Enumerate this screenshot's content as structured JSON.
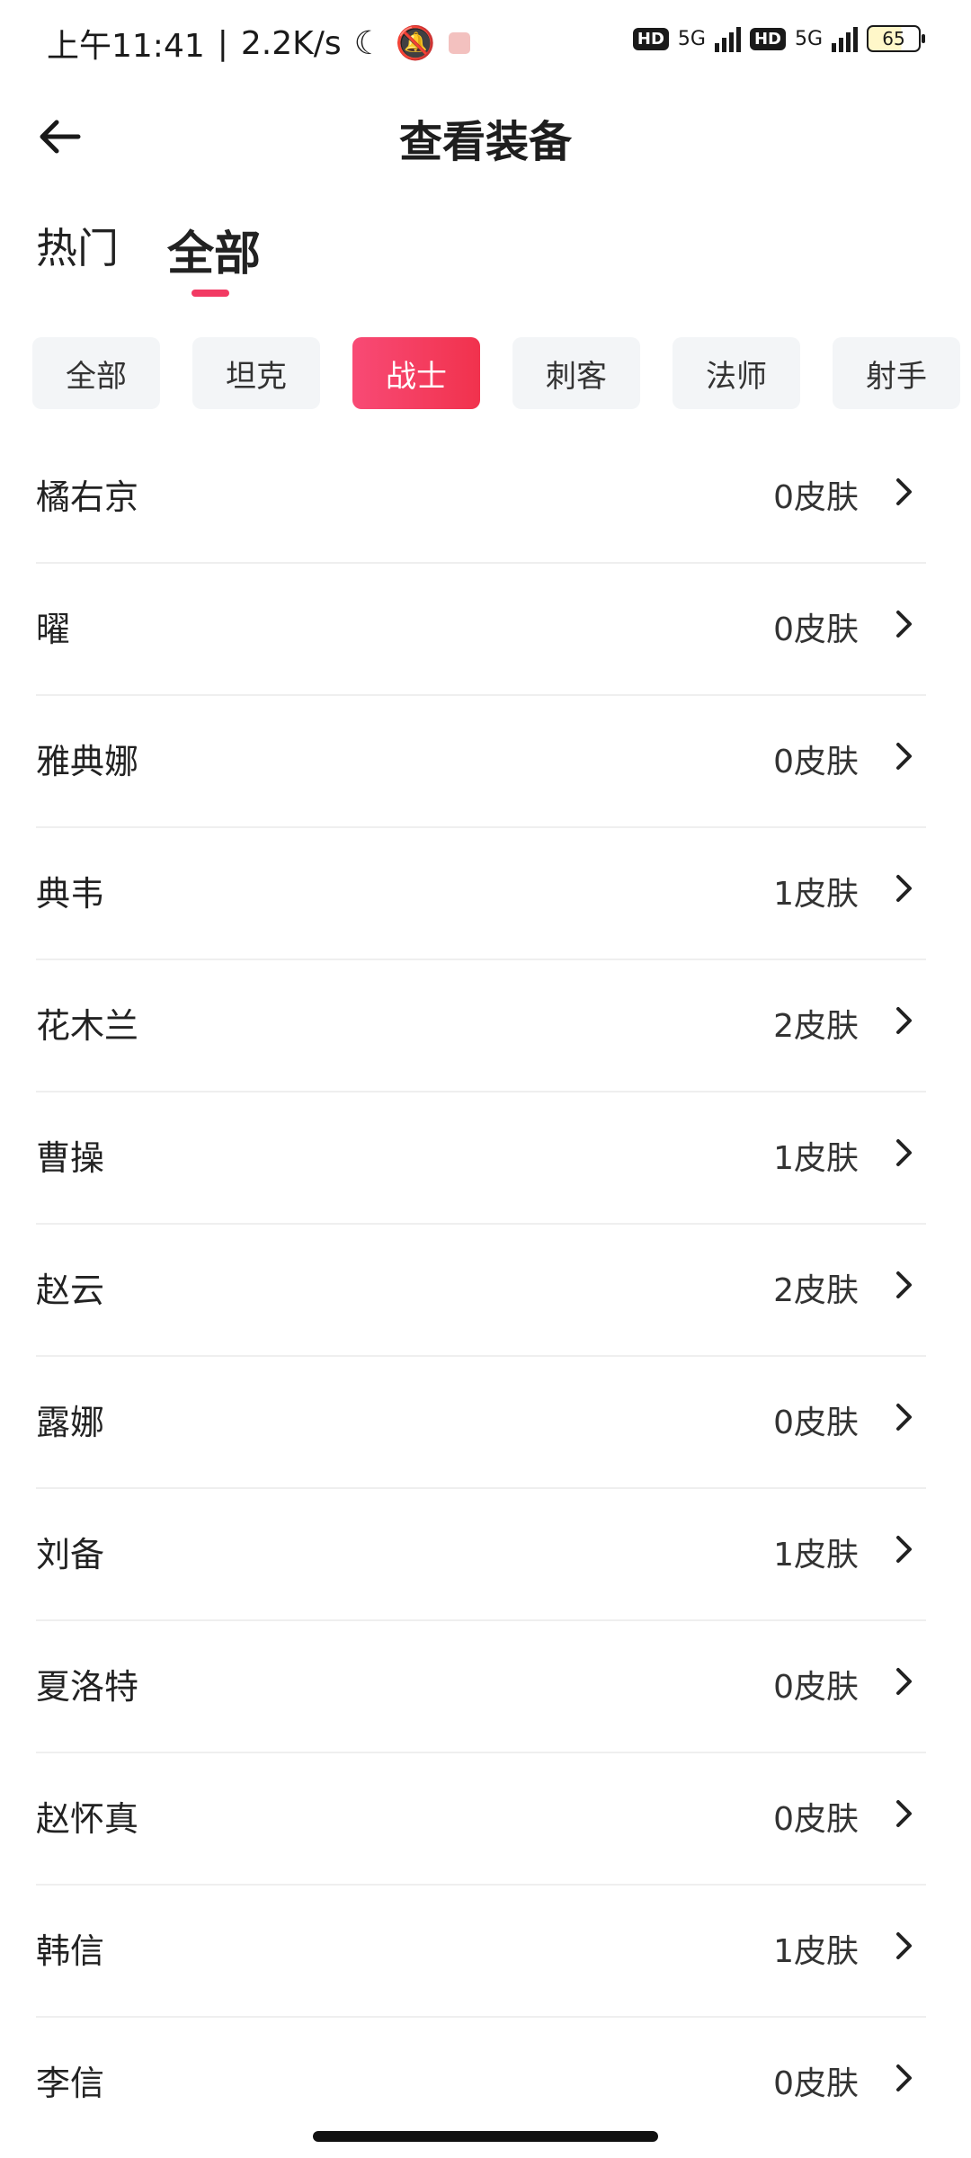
{
  "status_bar": {
    "time": "上午11:41",
    "speed": "2.2K/s",
    "sim1": "HD",
    "net1": "5G",
    "sim2": "HD",
    "net2": "5G",
    "battery": "65"
  },
  "header": {
    "title": "查看装备"
  },
  "tabs": [
    {
      "label": "热门"
    },
    {
      "label": "全部"
    }
  ],
  "chips": [
    {
      "label": "全部"
    },
    {
      "label": "坦克"
    },
    {
      "label": "战士"
    },
    {
      "label": "刺客"
    },
    {
      "label": "法师"
    },
    {
      "label": "射手"
    }
  ],
  "heroes": [
    {
      "name": "橘右京",
      "skins": "0皮肤"
    },
    {
      "name": "曜",
      "skins": "0皮肤"
    },
    {
      "name": "雅典娜",
      "skins": "0皮肤"
    },
    {
      "name": "典韦",
      "skins": "1皮肤"
    },
    {
      "name": "花木兰",
      "skins": "2皮肤"
    },
    {
      "name": "曹操",
      "skins": "1皮肤"
    },
    {
      "name": "赵云",
      "skins": "2皮肤"
    },
    {
      "name": "露娜",
      "skins": "0皮肤"
    },
    {
      "name": "刘备",
      "skins": "1皮肤"
    },
    {
      "name": "夏洛特",
      "skins": "0皮肤"
    },
    {
      "name": "赵怀真",
      "skins": "0皮肤"
    },
    {
      "name": "韩信",
      "skins": "1皮肤"
    },
    {
      "name": "李信",
      "skins": "0皮肤"
    }
  ],
  "colors": {
    "accent": "#f23a63",
    "chip_bg": "#f3f5f7"
  }
}
